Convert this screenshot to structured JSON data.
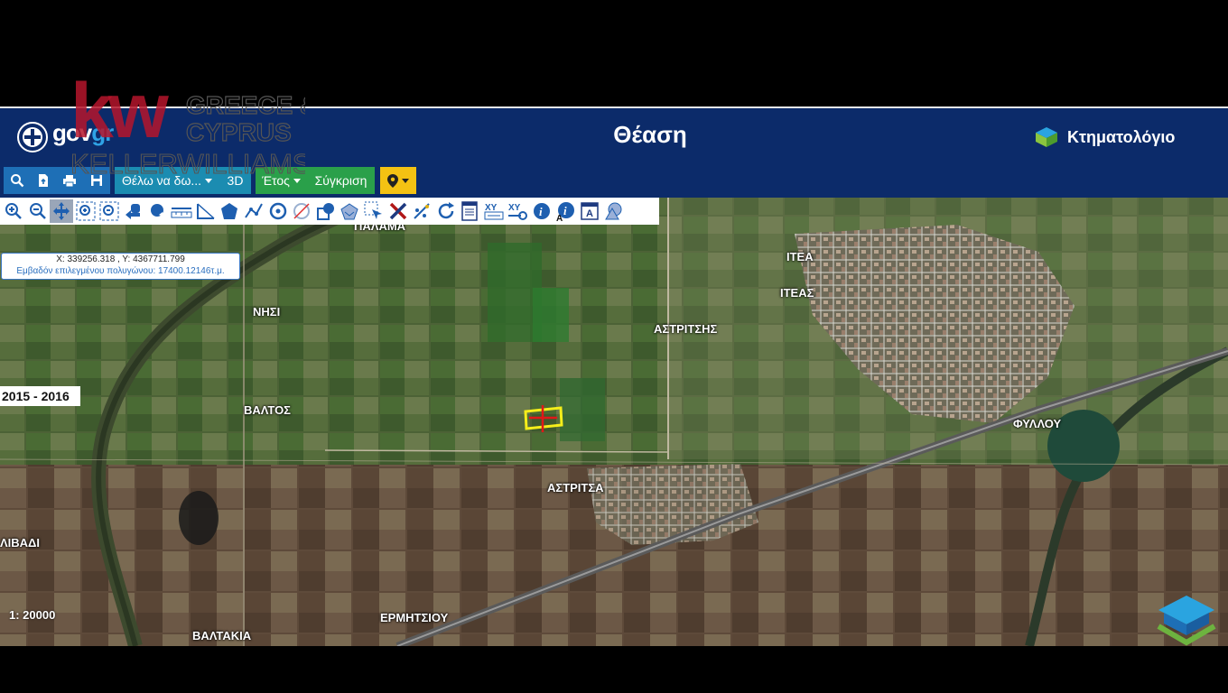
{
  "header": {
    "gov_brand_main": "gov",
    "gov_brand_accent": "gr",
    "title": "Θέαση",
    "ktimatologio": "Κτηματολόγιο"
  },
  "watermark": {
    "letters": "kw",
    "line1": "GREECE &",
    "line2": "CYPRUS",
    "line3": "KELLERWILLIAMS"
  },
  "toolbar": {
    "search_icon": "search-icon",
    "want_to_see": "Θέλω να δω...",
    "three_d": "3D",
    "year": "Έτος",
    "compare": "Σύγκριση",
    "marker_icon": "map-marker-icon"
  },
  "info": {
    "coords": "X: 339256.318 , Y: 4367711.799",
    "area": "Εμβαδόν επιλεγμένου πολυγώνου: 17400.12146τ.μ."
  },
  "year_range": "2015 - 2016",
  "scale": "1: 20000",
  "map_labels": {
    "palama": "ΠΑΛΑΜΑ",
    "nisi": "ΝΗΣΙ",
    "valtos": "ΒΑΛΤΟΣ",
    "livadi": "ΛΙΒΑΔΙ",
    "valtakia": "ΒΑΛΤΑΚΙΑ",
    "ermitsiou": "ΕΡΜΗΤΣΙΟΥ",
    "astritsa": "ΑΣΤΡΙΤΣΑ",
    "astritsis": "ΑΣΤΡΙΤΣΗΣ",
    "itea": "ΙΤΕΑ",
    "iteas": "ΙΤΕΑΣ",
    "fyllou": "ΦΥΛΛΟΥ"
  },
  "colors": {
    "header_bg": "#0c2b6a",
    "button_blue": "#1e6fb6",
    "button_teal": "#1b8cb1",
    "button_green": "#2aa04a",
    "button_yellow": "#f4c213",
    "selection_yellow": "#f5ee1a",
    "kw_red": "#b5152b"
  }
}
